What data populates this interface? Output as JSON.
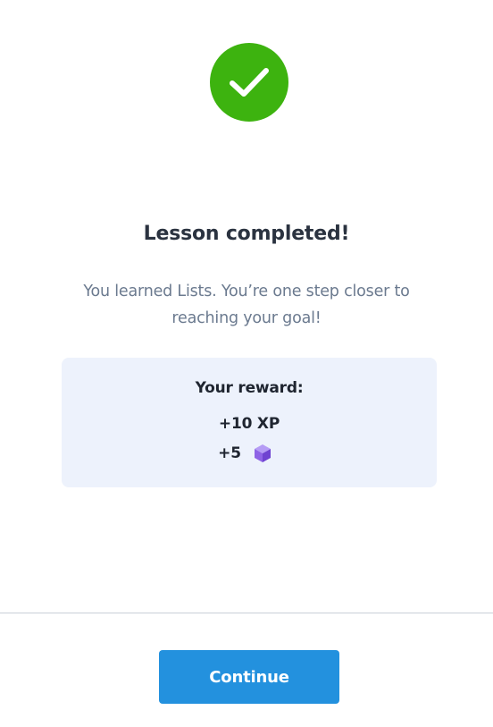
{
  "status_icon": "checkmark-icon",
  "title": "Lesson completed!",
  "subtitle": "You learned Lists. You’re one step closer to reaching your goal!",
  "reward": {
    "heading": "Your reward:",
    "xp": "+10 XP",
    "gems": "+5",
    "gem_icon": "gem-cube-icon"
  },
  "footer": {
    "continue_label": "Continue"
  },
  "colors": {
    "success": "#3db30f",
    "card_background": "#edf2fc",
    "button": "#2391de",
    "gem": "#8e63e6"
  }
}
